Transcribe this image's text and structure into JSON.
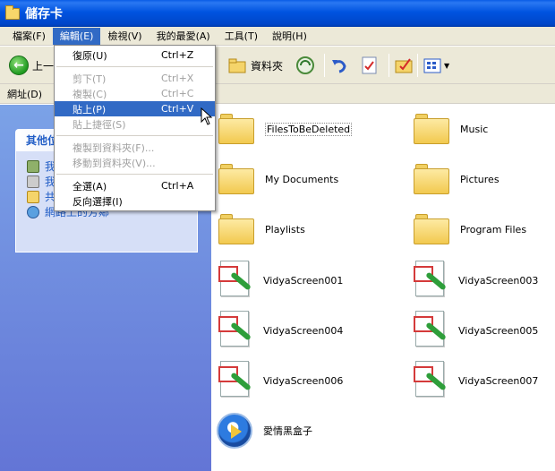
{
  "window": {
    "title": "儲存卡"
  },
  "menubar": {
    "items": [
      {
        "label": "檔案(F)"
      },
      {
        "label": "編輯(E)"
      },
      {
        "label": "檢視(V)"
      },
      {
        "label": "我的最愛(A)"
      },
      {
        "label": "工具(T)"
      },
      {
        "label": "說明(H)"
      }
    ]
  },
  "toolbar": {
    "back_label": "上一",
    "folders_label": "資料夾"
  },
  "addressbar": {
    "label": "網址(D)"
  },
  "leftpane": {
    "panel_title": "其他位",
    "places": [
      {
        "label": "我"
      },
      {
        "label": "我"
      },
      {
        "label": "共"
      },
      {
        "label": "網路上的芳鄰"
      }
    ]
  },
  "edit_menu": {
    "items": [
      {
        "label": "復原(U)",
        "accel": "Ctrl+Z",
        "disabled": false
      },
      {
        "label": "剪下(T)",
        "accel": "Ctrl+X",
        "disabled": true
      },
      {
        "label": "複製(C)",
        "accel": "Ctrl+C",
        "disabled": true
      },
      {
        "label": "貼上(P)",
        "accel": "Ctrl+V",
        "disabled": false
      },
      {
        "label": "貼上捷徑(S)",
        "accel": "",
        "disabled": true
      },
      {
        "label": "複製到資料夾(F)...",
        "accel": "",
        "disabled": true
      },
      {
        "label": "移動到資料夾(V)...",
        "accel": "",
        "disabled": true
      },
      {
        "label": "全選(A)",
        "accel": "Ctrl+A",
        "disabled": false
      },
      {
        "label": "反向選擇(I)",
        "accel": "",
        "disabled": false
      }
    ]
  },
  "files": [
    {
      "name": "FilesToBeDeleted",
      "type": "folder"
    },
    {
      "name": "Music",
      "type": "folder"
    },
    {
      "name": "My Documents",
      "type": "folder"
    },
    {
      "name": "Pictures",
      "type": "folder"
    },
    {
      "name": "Playlists",
      "type": "folder"
    },
    {
      "name": "Program Files",
      "type": "folder"
    },
    {
      "name": "VidyaScreen001",
      "type": "image"
    },
    {
      "name": "VidyaScreen003",
      "type": "image"
    },
    {
      "name": "VidyaScreen004",
      "type": "image"
    },
    {
      "name": "VidyaScreen005",
      "type": "image"
    },
    {
      "name": "VidyaScreen006",
      "type": "image"
    },
    {
      "name": "VidyaScreen007",
      "type": "image"
    },
    {
      "name": "愛情黑盒子",
      "type": "media"
    }
  ],
  "colors": {
    "title_bar": "#0053e0",
    "menu_highlight": "#316ac5",
    "task_pane": "#7ba2e7"
  }
}
